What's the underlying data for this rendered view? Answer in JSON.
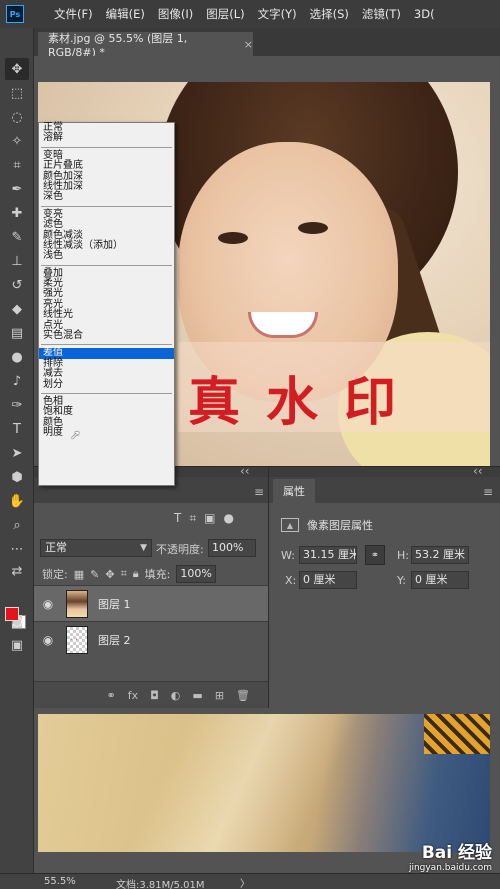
{
  "app": {
    "logo": "Ps"
  },
  "menu": [
    "文件(F)",
    "编辑(E)",
    "图像(I)",
    "图层(L)",
    "文字(Y)",
    "选择(S)",
    "滤镜(T)",
    "3D("
  ],
  "tab": {
    "title": "素材.jpg @ 55.5% (图层 1, RGB/8#) *",
    "close": "×"
  },
  "watermark_text": "真水印",
  "blend_menu": {
    "groups": [
      [
        "正常",
        "溶解"
      ],
      [
        "变暗",
        "正片叠底",
        "颜色加深",
        "线性加深",
        "深色"
      ],
      [
        "变亮",
        "滤色",
        "颜色减淡",
        "线性减淡（添加）",
        "浅色"
      ],
      [
        "叠加",
        "柔光",
        "强光",
        "亮光",
        "线性光",
        "点光",
        "实色混合"
      ],
      [
        "差值",
        "排除",
        "减去",
        "划分"
      ],
      [
        "色相",
        "饱和度",
        "颜色",
        "明度"
      ]
    ],
    "highlighted": "差值"
  },
  "layers_panel": {
    "blend_mode": "正常",
    "opacity_label": "不透明度:",
    "opacity": "100%",
    "lock_label": "锁定:",
    "fill_label": "填充:",
    "fill": "100%",
    "layers": [
      {
        "name": "图层 1",
        "selected": true
      },
      {
        "name": "图层 2",
        "selected": false
      }
    ],
    "footer_icons": [
      "link-icon",
      "fx-icon",
      "mask-icon",
      "adjustment-icon",
      "folder-icon",
      "new-layer-icon",
      "trash-icon"
    ],
    "footer_fx": "fx"
  },
  "properties": {
    "tab": "属性",
    "subtitle": "像素图层属性",
    "w_label": "W:",
    "w": "31.15 厘米",
    "h_label": "H:",
    "h": "53.2 厘米",
    "x_label": "X:",
    "x": "0 厘米",
    "y_label": "Y:",
    "y": "0 厘米"
  },
  "status": {
    "zoom": "55.5%",
    "doc": "文档:3.81M/5.01M",
    "arrow": "〉"
  },
  "watermark_site": {
    "brand": "Bai 经验",
    "url": "jingyan.baidu.com"
  },
  "colors": {
    "foreground": "#e3151a",
    "background": "#ffffff",
    "highlight": "#0a64d8",
    "watermark": "#d31d22"
  }
}
